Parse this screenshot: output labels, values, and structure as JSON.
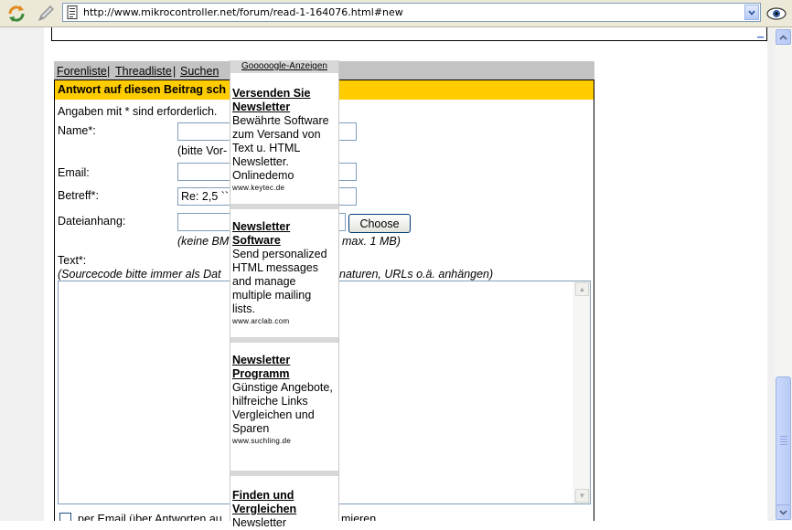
{
  "browser": {
    "url": "http://www.mikrocontroller.net/forum/read-1-164076.html#new",
    "reload_icon": "refresh-icon",
    "edit_icon": "pencil-icon",
    "page_icon": "page-icon",
    "view_icon": "eye-icon"
  },
  "nav": {
    "forenliste": "Forenliste",
    "sep1": "|",
    "threadliste": "Threadliste",
    "sep2": "|",
    "suchen": "Suchen"
  },
  "form": {
    "header": "Antwort auf diesen Beitrag sch",
    "required_note": "Angaben mit * sind erforderlich.",
    "name_label": "Name*:",
    "name_hint": "(bitte Vor-",
    "email_label": "Email:",
    "betreff_label": "Betreff*:",
    "betreff_value": "Re: 2,5 ``",
    "dateianhang_label": "Dateianhang:",
    "choose_button": "Choose",
    "attachment_hint_left": "(keine BM",
    "attachment_hint_right": "max. 1 MB)",
    "text_label": "Text*:",
    "text_hint_left": "(Sourcecode bitte immer als Dat",
    "text_hint_right": "naturen, URLs o.ä. anhängen)",
    "notify_left": "per Email über Antworten au",
    "notify_right": "mieren"
  },
  "ads": {
    "header": "Gooooogle-Anzeigen",
    "items": [
      {
        "title": "Versenden Sie Newsletter",
        "desc": "Bewährte Software zum Versand von Text u. HTML Newsletter. Onlinedemo",
        "url": "www.keytec.de"
      },
      {
        "title": "Newsletter Software",
        "desc": "Send personalized HTML messages and manage multiple mailing lists.",
        "url": "www.arclab.com"
      },
      {
        "title": "Newsletter Programm",
        "desc": "Günstige Angebote, hilfreiche Links Vergleichen und Sparen",
        "url": "www.suchling.de"
      },
      {
        "title": "Finden und Vergleichen",
        "desc": "Newsletter",
        "url": ""
      }
    ]
  },
  "colors": {
    "form_header_bg": "#ffcc00",
    "nav_bg": "#c3c3c3",
    "toolbar_bg": "#ece9d8"
  }
}
